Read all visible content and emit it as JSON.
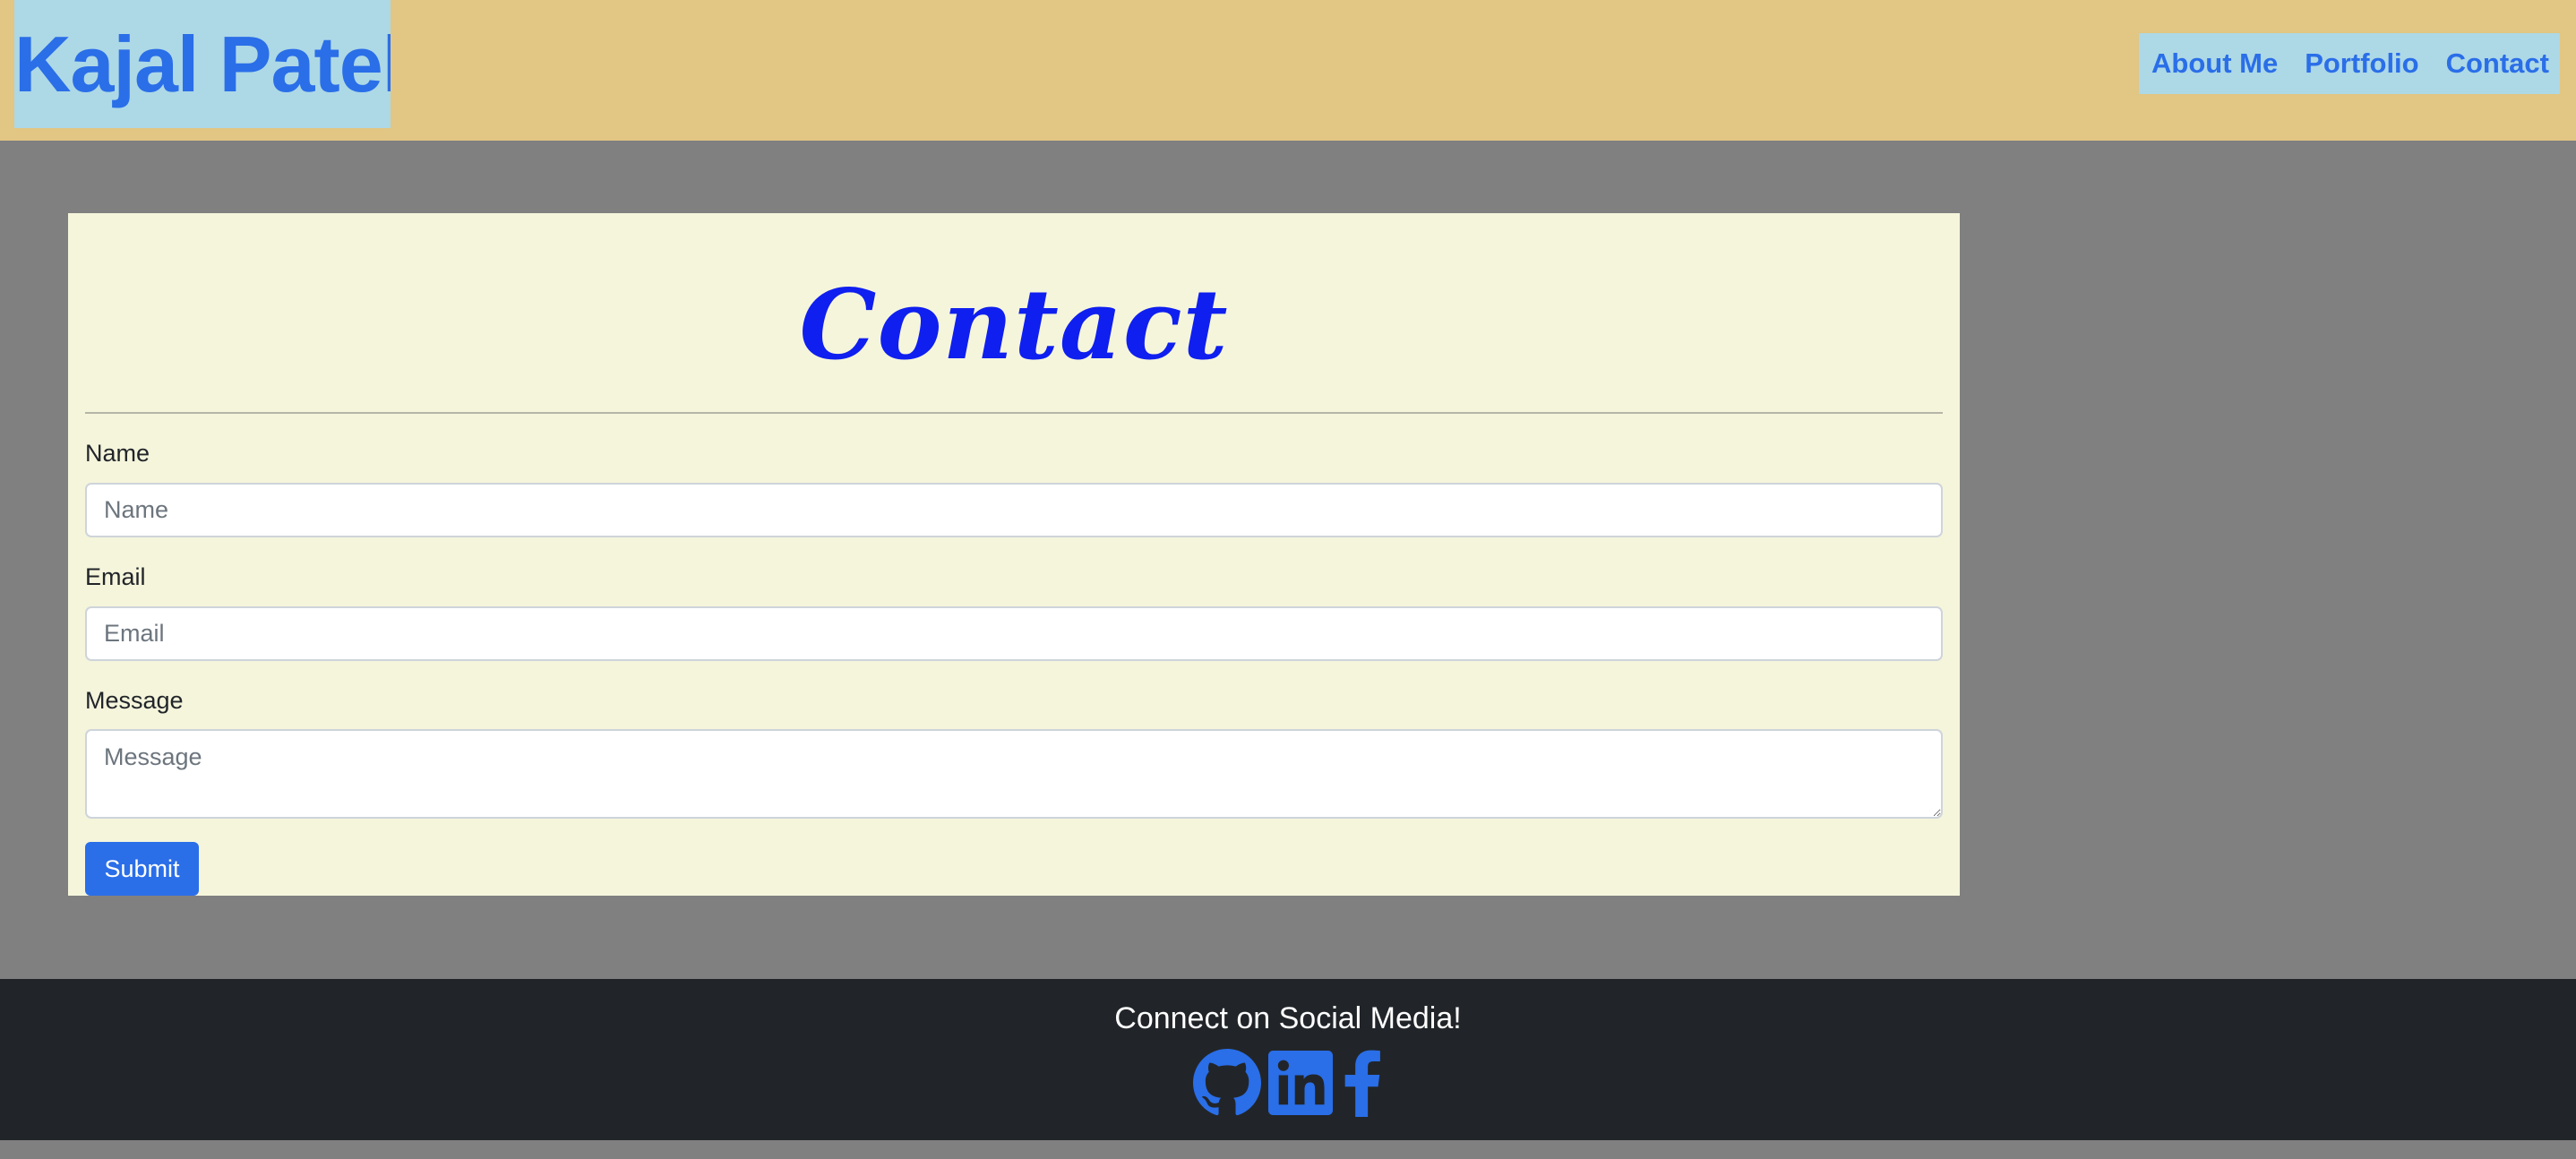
{
  "header": {
    "brand": "Kajal Patel",
    "nav": [
      "About Me",
      "Portfolio",
      "Contact"
    ]
  },
  "contact": {
    "title": "Contact",
    "fields": {
      "name": {
        "label": "Name",
        "placeholder": "Name",
        "value": ""
      },
      "email": {
        "label": "Email",
        "placeholder": "Email",
        "value": ""
      },
      "message": {
        "label": "Message",
        "placeholder": "Message",
        "value": ""
      }
    },
    "submit_label": "Submit"
  },
  "footer": {
    "title": "Connect on Social Media!",
    "icons": [
      "github-icon",
      "linkedin-icon",
      "facebook-icon"
    ]
  },
  "colors": {
    "header_bg": "#e2c683",
    "brand_bg": "#add8e6",
    "accent": "#2a6ee8",
    "title": "#0f1fef",
    "card_bg": "#f5f5dc",
    "page_bg": "#808080",
    "footer_bg": "#212529"
  }
}
